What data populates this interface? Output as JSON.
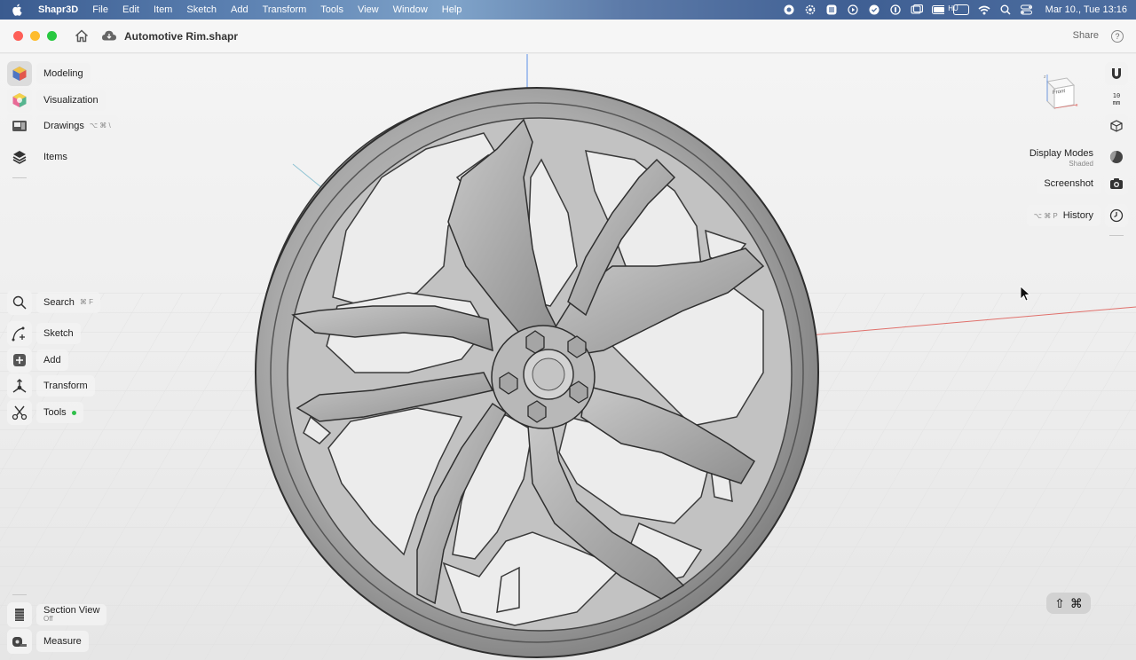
{
  "menubar": {
    "app_name": "Shapr3D",
    "items": [
      "File",
      "Edit",
      "Item",
      "Sketch",
      "Add",
      "Transform",
      "Tools",
      "View",
      "Window",
      "Help"
    ],
    "input_source": "HU",
    "clock": "Mar 10., Tue  13:16"
  },
  "titlebar": {
    "document_title": "Automotive Rim.shapr",
    "share_label": "Share",
    "help_label": "?"
  },
  "left_toolbar": {
    "modeling": "Modeling",
    "visualization": "Visualization",
    "drawings": "Drawings",
    "drawings_shortcut": "⌥  ⌘  \\",
    "items": "Items",
    "search": "Search",
    "search_shortcut": "⌘  F",
    "sketch": "Sketch",
    "add": "Add",
    "transform": "Transform",
    "tools": "Tools",
    "section_view": "Section View",
    "section_view_state": "Off",
    "measure": "Measure"
  },
  "right_toolbar": {
    "units_value": "10",
    "units_unit": "mm",
    "view_cube_face": "Front",
    "display_modes": "Display Modes",
    "display_mode_value": "Shaded",
    "screenshot": "Screenshot",
    "history": "History",
    "history_shortcut": "⌥  ⌘  P"
  },
  "shortcut_pill": {
    "shift": "⇧",
    "cmd": "⌘"
  },
  "colors": {
    "x_axis": "#e0706b",
    "y_axis": "#8fc3d3",
    "z_axis": "#5b8fe6",
    "accent_green": "#2fbf4a"
  }
}
